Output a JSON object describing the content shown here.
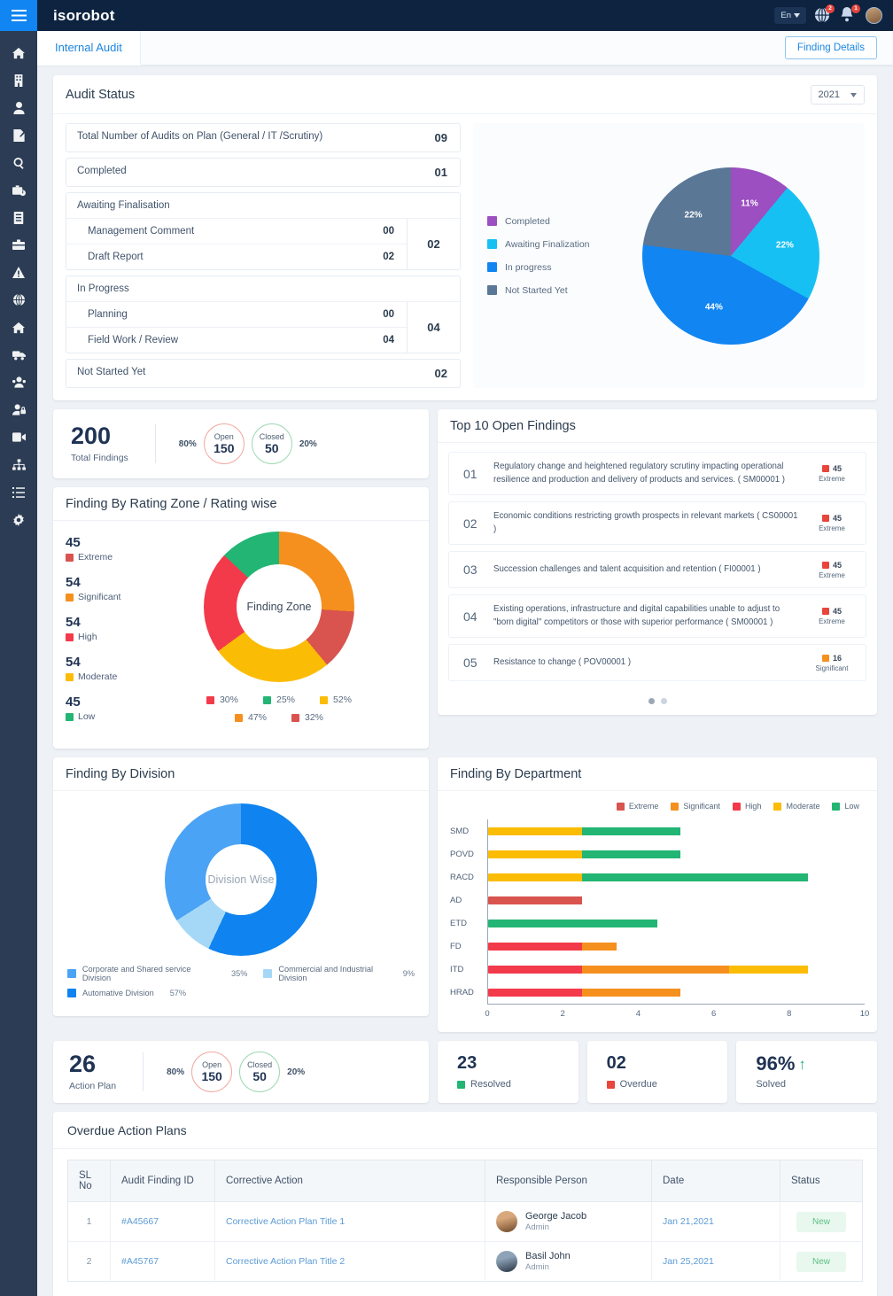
{
  "brand": "isorobot",
  "topbar": {
    "language": "En",
    "messages_badge": "2",
    "alerts_badge": "1",
    "menu_icon": "hamburger-menu-icon",
    "globe_icon": "globe-notification-icon",
    "bell_icon": "bell-notification-icon",
    "avatar_icon": "user-avatar"
  },
  "sidebar": {
    "items": [
      {
        "icon": "home-icon"
      },
      {
        "icon": "building-icon"
      },
      {
        "icon": "user-icon"
      },
      {
        "icon": "document-edit-icon"
      },
      {
        "icon": "search-icon"
      },
      {
        "icon": "briefcase-clock-icon"
      },
      {
        "icon": "document-list-icon"
      },
      {
        "icon": "briefcase-icon"
      },
      {
        "icon": "warning-triangle-icon"
      },
      {
        "icon": "globe-icon"
      },
      {
        "icon": "home-alt-icon"
      },
      {
        "icon": "truck-icon"
      },
      {
        "icon": "users-icon"
      },
      {
        "icon": "user-lock-icon"
      },
      {
        "icon": "video-icon"
      },
      {
        "icon": "sitemap-icon"
      },
      {
        "icon": "list-icon"
      },
      {
        "icon": "gear-icon"
      }
    ]
  },
  "tabs": {
    "active": "Internal Audit",
    "finding_details_button": "Finding Details"
  },
  "audit_status": {
    "title": "Audit Status",
    "year": "2021",
    "rows": [
      {
        "label": "Total Number of Audits on Plan (General / IT /Scrutiny)",
        "value": "09"
      },
      {
        "label": "Completed",
        "value": "01"
      }
    ],
    "groups": [
      {
        "header": "Awaiting Finalisation",
        "total": "02",
        "rows": [
          {
            "label": "Management Comment",
            "value": "00"
          },
          {
            "label": "Draft Report",
            "value": "02"
          }
        ]
      },
      {
        "header": "In Progress",
        "total": "04",
        "rows": [
          {
            "label": "Planning",
            "value": "00"
          },
          {
            "label": "Field Work / Review",
            "value": "04"
          }
        ]
      }
    ],
    "last_row": {
      "label": "Not Started Yet",
      "value": "02"
    },
    "chart_data": {
      "type": "pie",
      "title": "Audit Status",
      "categories": [
        "Completed",
        "Awaiting Finalization",
        "In progress",
        "Not Started Yet"
      ],
      "values": [
        11,
        22,
        44,
        22
      ],
      "labels": [
        "11%",
        "22%",
        "44%",
        "22%"
      ],
      "colors": [
        "#9b4fc0",
        "#17c0f2",
        "#1185f1",
        "#5a7796"
      ],
      "legend_position": "left"
    }
  },
  "total_findings": {
    "number": "200",
    "label": "Total Findings",
    "open": {
      "label": "Open",
      "value": "150",
      "pct": "80%"
    },
    "closed": {
      "label": "Closed",
      "value": "50",
      "pct": "20%"
    }
  },
  "rating_zone": {
    "title": "Finding By Rating Zone / Rating wise",
    "center_label": "Finding Zone",
    "chart_data": {
      "type": "pie",
      "title": "Finding By Rating Zone / Rating wise",
      "categories": [
        "Extreme",
        "Significant",
        "High",
        "Moderate",
        "Low"
      ],
      "values": [
        45,
        54,
        54,
        54,
        45
      ],
      "colors": [
        "#d9534f",
        "#f5901e",
        "#f33a4b",
        "#fbbc05",
        "#22b573"
      ],
      "segment_pcts": [
        13,
        26,
        22,
        26,
        13
      ],
      "percent_chips": [
        {
          "pct": "30%",
          "color": "#f33a4b"
        },
        {
          "pct": "25%",
          "color": "#22b573"
        },
        {
          "pct": "52%",
          "color": "#fbbc05"
        },
        {
          "pct": "47%",
          "color": "#f5901e"
        },
        {
          "pct": "32%",
          "color": "#d9534f"
        }
      ]
    }
  },
  "top_findings": {
    "title": "Top 10 Open Findings",
    "items": [
      {
        "no": "01",
        "text": "Regulatory change and heightened regulatory scrutiny impacting operational resilience and production and delivery of products and services. ( SM00001 )",
        "count": "45",
        "rating": "Extreme",
        "color": "#e8453c"
      },
      {
        "no": "02",
        "text": "Economic conditions restricting growth prospects in relevant markets ( CS00001 )",
        "count": "45",
        "rating": "Extreme",
        "color": "#e8453c"
      },
      {
        "no": "03",
        "text": "Succession challenges and talent acquisition and retention ( FI00001 )",
        "count": "45",
        "rating": "Extreme",
        "color": "#e8453c"
      },
      {
        "no": "04",
        "text": "Existing operations, infrastructure and digital capabilities unable to adjust to \"born digital\" competitors or those with superior performance ( SM00001 )",
        "count": "45",
        "rating": "Extreme",
        "color": "#e8453c"
      },
      {
        "no": "05",
        "text": "Resistance to change ( POV00001 )",
        "count": "16",
        "rating": "Significant",
        "color": "#f5901e"
      }
    ]
  },
  "division": {
    "title": "Finding By Division",
    "center_label": "Division Wise",
    "chart_data": {
      "type": "pie",
      "title": "Finding By Division",
      "categories": [
        "Corporate and Shared service Division",
        "Commercial and Industrial Division",
        "Automative Division"
      ],
      "values": [
        35,
        9,
        57
      ],
      "labels": [
        "35%",
        "9%",
        "57%"
      ],
      "colors": [
        "#4ba3f5",
        "#a5d8f7",
        "#0f83f0"
      ],
      "legend_position": "bottom"
    }
  },
  "department": {
    "title": "Finding By Department",
    "chart_data": {
      "type": "bar",
      "orientation": "horizontal",
      "stacked": true,
      "title": "Finding By Department",
      "categories": [
        "SMD",
        "POVD",
        "RACD",
        "AD",
        "ETD",
        "FD",
        "ITD",
        "HRAD"
      ],
      "series": [
        {
          "name": "Extreme",
          "color": "#d9534f",
          "values": [
            0,
            0,
            0,
            2.5,
            0,
            0,
            0,
            0
          ]
        },
        {
          "name": "Significant",
          "color": "#f5901e",
          "values": [
            0,
            0,
            0,
            0,
            0,
            0.9,
            3.9,
            2.6
          ]
        },
        {
          "name": "High",
          "color": "#f33a4b",
          "values": [
            0,
            0,
            0,
            0,
            0,
            2.5,
            2.5,
            2.5
          ]
        },
        {
          "name": "Moderate",
          "color": "#fbbc05",
          "values": [
            2.5,
            2.5,
            2.5,
            0,
            0,
            0,
            2.1,
            0
          ]
        },
        {
          "name": "Low",
          "color": "#22b573",
          "values": [
            2.6,
            2.6,
            6.0,
            0,
            4.5,
            0,
            0,
            0
          ]
        }
      ],
      "xlabel": "",
      "ylabel": "",
      "xticks": [
        "0",
        "2",
        "4",
        "6",
        "8",
        "10"
      ],
      "xlim": [
        0,
        10
      ],
      "grid": false,
      "legend_position": "top-right"
    }
  },
  "action_plan": {
    "number": "26",
    "label": "Action Plan",
    "open": {
      "label": "Open",
      "value": "150",
      "pct": "80%"
    },
    "closed": {
      "label": "Closed",
      "value": "50",
      "pct": "20%"
    },
    "resolved": {
      "value": "23",
      "label": "Resolved",
      "color": "#22b573"
    },
    "overdue": {
      "value": "02",
      "label": "Overdue",
      "color": "#e8453c"
    },
    "solved": {
      "value": "96%",
      "label": "Solved",
      "arrow": "up"
    }
  },
  "overdue_table": {
    "title": "Overdue Action Plans",
    "columns": [
      "SL No",
      "Audit Finding ID",
      "Corrective Action",
      "Responsible Person",
      "Date",
      "Status"
    ],
    "rows": [
      {
        "sl": "1",
        "finding_id": "#A45667",
        "action": "Corrective Action Plan Title 1",
        "person": "George Jacob",
        "role": "Admin",
        "date": "Jan 21,2021",
        "status": "New"
      },
      {
        "sl": "2",
        "finding_id": "#A45767",
        "action": "Corrective Action Plan Title 2",
        "person": "Basil John",
        "role": "Admin",
        "date": "Jan 25,2021",
        "status": "New"
      }
    ]
  }
}
